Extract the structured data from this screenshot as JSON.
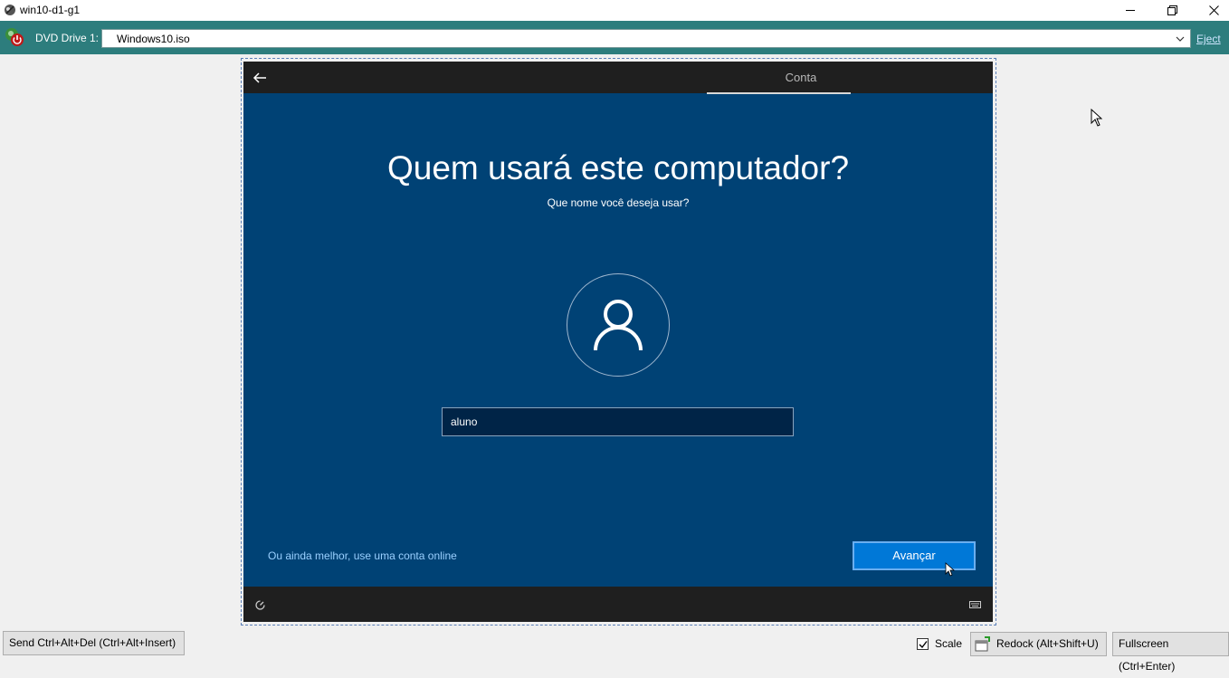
{
  "window": {
    "title": "win10-d1-g1"
  },
  "dvd": {
    "label": "DVD Drive 1:",
    "image": "Windows10.iso",
    "eject_label": "Eject"
  },
  "vm": {
    "step_label": "Conta",
    "heading": "Quem usará este computador?",
    "subheading": "Que nome você deseja usar?",
    "name_value": "aluno",
    "online_link": "Ou ainda melhor, use uma conta online",
    "next_label": "Avançar"
  },
  "bottom": {
    "send_cad": "Send Ctrl+Alt+Del (Ctrl+Alt+Insert)",
    "scale_label": "Scale",
    "scale_checked": true,
    "redock": "Redock (Alt+Shift+U)",
    "fullscreen": "Fullscreen (Ctrl+Enter)"
  },
  "colors": {
    "vm_background": "#004275",
    "vm_accent": "#0078d7",
    "toolbar": "#2d7d7d"
  }
}
